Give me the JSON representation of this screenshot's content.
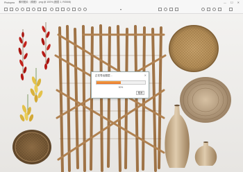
{
  "window": {
    "app_name": "Photopea",
    "file_title": "素材图片（原图）.png @ 100% (图层 1, RGB/8)",
    "minimize": "—",
    "maximize": "☐",
    "close": "✕"
  },
  "toolbar": {
    "icons": [
      "open-file-icon",
      "save-icon",
      "undo-icon",
      "redo-icon",
      "crop-icon",
      "rotate-icon",
      "flip-icon",
      "resize-icon",
      "adjust-icon",
      "filter-icon",
      "text-icon",
      "brush-icon",
      "eraser-icon",
      "zoom-in-icon",
      "zoom-out-icon",
      "fit-icon",
      "settings-icon",
      "share-icon",
      "print-icon",
      "info-icon",
      "fullscreen-icon",
      "help-icon",
      "export-icon",
      "close-doc-icon"
    ],
    "collapse_arrow": "▾"
  },
  "dialog": {
    "title": "正在导出图层…",
    "close": "✕",
    "progress": 0.5,
    "progress_text": "50%",
    "cancel_label": "取消"
  },
  "colors": {
    "progress_start": "#f5a548",
    "progress_end": "#e8742a",
    "chili_red": "#b61a16",
    "bamboo": "#b08150",
    "straw": "#c9a46e",
    "ceramic": "#c8ae8a"
  }
}
